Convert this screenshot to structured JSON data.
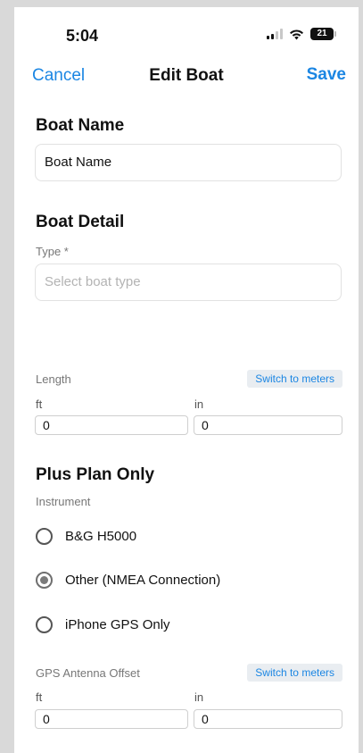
{
  "status_bar": {
    "time": "5:04",
    "battery": "21"
  },
  "nav": {
    "cancel": "Cancel",
    "title": "Edit Boat",
    "save": "Save"
  },
  "boat_name": {
    "heading": "Boat Name",
    "value": "Boat Name"
  },
  "boat_detail": {
    "heading": "Boat Detail",
    "type_label": "Type *",
    "type_placeholder": "Select boat type",
    "length_label": "Length",
    "switch_label": "Switch to meters",
    "ft_label": "ft",
    "in_label": "in",
    "ft_value": "0",
    "in_value": "0"
  },
  "plus_plan": {
    "heading": "Plus Plan Only",
    "instrument_label": "Instrument",
    "options": [
      {
        "label": "B&G H5000",
        "selected": false
      },
      {
        "label": "Other (NMEA Connection)",
        "selected": true
      },
      {
        "label": "iPhone GPS Only",
        "selected": false
      }
    ],
    "gps_offset_label": "GPS Antenna Offset",
    "switch_label": "Switch to meters",
    "ft_label": "ft",
    "in_label": "in",
    "ft_value": "0",
    "in_value": "0"
  },
  "colors": {
    "accent": "#1b86e3",
    "switch_bg": "#e9edf1",
    "label_gray": "#777777"
  }
}
